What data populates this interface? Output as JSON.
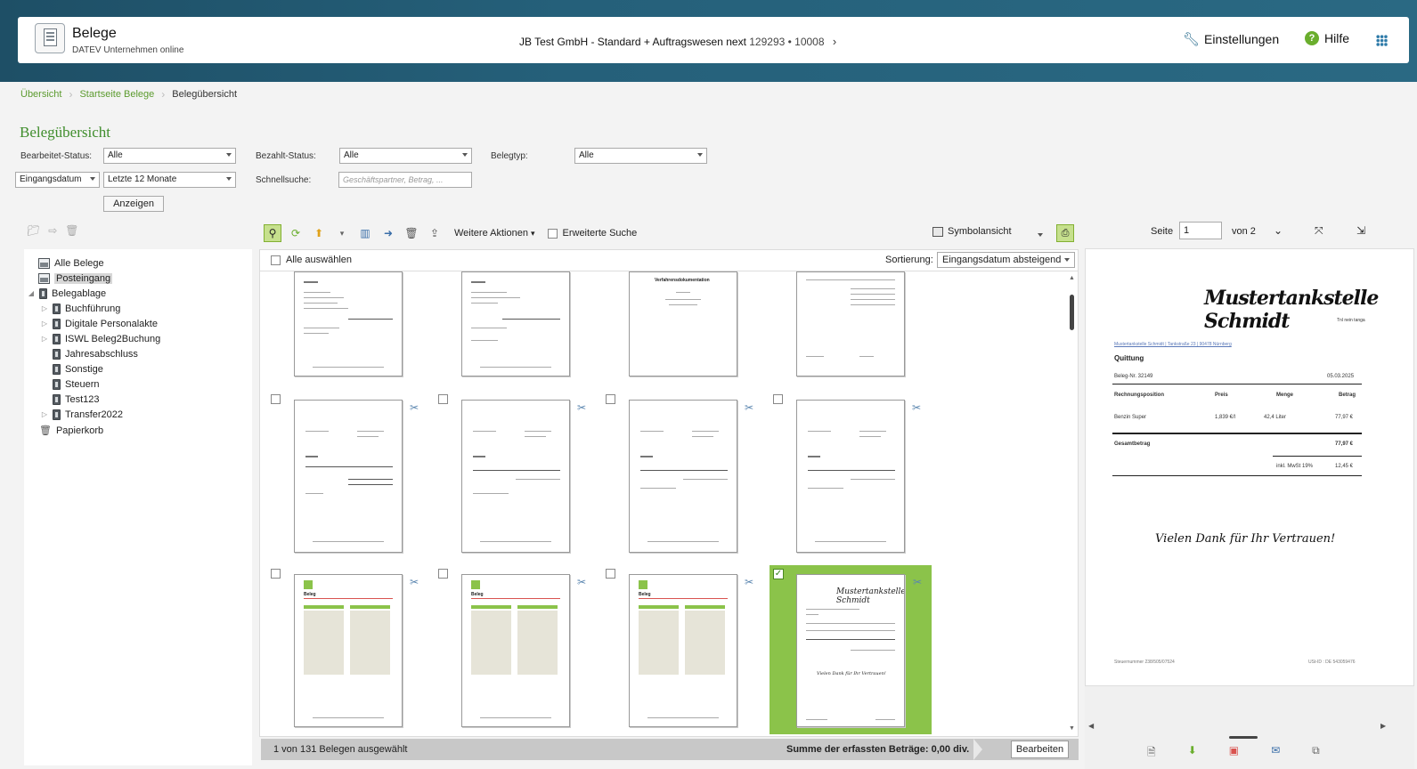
{
  "app": {
    "title": "Belege",
    "subtitle": "DATEV Unternehmen online"
  },
  "company": {
    "name": "JB Test GmbH - Standard + Auftragswesen next",
    "numbers": "129293 • 10008",
    "chevron": "›"
  },
  "header": {
    "settings_label": "Einstellungen",
    "help_label": "Hilfe",
    "help_glyph": "?"
  },
  "breadcrumb": {
    "items": [
      "Übersicht",
      "Startseite Belege",
      "Belegübersicht"
    ],
    "separator": "›"
  },
  "page_title": "Belegübersicht",
  "filters": {
    "bearbeitet_label": "Bearbeitet-Status:",
    "bearbeitet_value": "Alle",
    "bezahlt_label": "Bezahlt-Status:",
    "bezahlt_value": "Alle",
    "belegtyp_label": "Belegtyp:",
    "belegtyp_value": "Alle",
    "date_field_value": "Eingangsdatum",
    "period_value": "Letzte 12 Monate",
    "quicksearch_label": "Schnellsuche:",
    "quicksearch_placeholder": "Geschäftspartner, Betrag, ...",
    "show_button": "Anzeigen"
  },
  "tree": {
    "items": [
      {
        "label": "Alle Belege"
      },
      {
        "label": "Posteingang"
      },
      {
        "label": "Belegablage"
      },
      {
        "label": "Buchführung"
      },
      {
        "label": "Digitale Personalakte"
      },
      {
        "label": "ISWL Beleg2Buchung"
      },
      {
        "label": "Jahresabschluss"
      },
      {
        "label": "Sonstige"
      },
      {
        "label": "Steuern"
      },
      {
        "label": "Test123"
      },
      {
        "label": "Transfer2022"
      },
      {
        "label": "Papierkorb"
      }
    ]
  },
  "toolbar": {
    "more_actions": "Weitere Aktionen",
    "extended_search": "Erweiterte Suche",
    "view_mode": "Symbolansicht"
  },
  "grid": {
    "select_all": "Alle auswählen",
    "sort_label": "Sortierung:",
    "sort_value": "Eingangsdatum absteigend",
    "thumb_title_1": "Verfahrensdokumentation",
    "thumb_script": "Mustertankstelle Schmidt",
    "thumb_thanks": "Vielen Dank für Ihr Vertrauen!",
    "thumb_invoice_heading": "Beleg"
  },
  "status": {
    "selection": "1 von 131 Belegen ausgewählt",
    "sum": "Summe der erfassten Beträge: 0,00 div.",
    "edit_button": "Bearbeiten"
  },
  "preview": {
    "page_label": "Seite",
    "page_value": "1",
    "of_label": "von 2",
    "doc": {
      "company_script": "Mustertankstelle Schmidt",
      "tagline": "Tnl nein tanga",
      "address": "Mustertankstelle Schmidt | Tankstraße 23 | 90478 Nürnberg",
      "heading": "Quittung",
      "beleg_nr": "Beleg-Nr. 32149",
      "date": "05.03.2025",
      "col_position": "Rechnungsposition",
      "col_preis": "Preis",
      "col_menge": "Menge",
      "col_betrag": "Betrag",
      "row_item": "Benzin Super",
      "row_preis": "1,839 €/l",
      "row_menge": "42,4 Liter",
      "row_betrag": "77,97 €",
      "total_label": "Gesamtbetrag",
      "total_value": "77,97 €",
      "vat_label": "inkl. MwSt 19%",
      "vat_value": "12,45 €",
      "thanks": "Vielen Dank für Ihr Vertrauen!",
      "footer_left": "Steuernummer 238/505/07524",
      "footer_right": "USt-ID : DE 543059476"
    }
  }
}
